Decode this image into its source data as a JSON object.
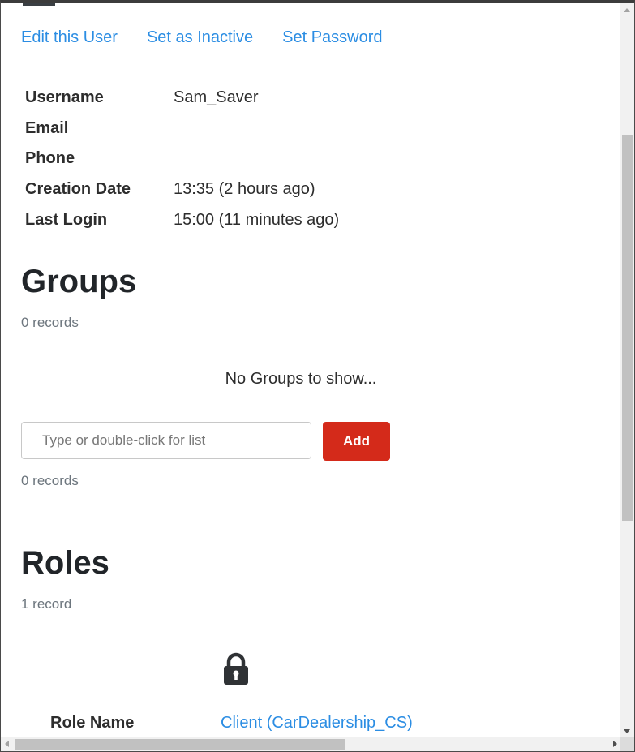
{
  "actions": {
    "edit_user": "Edit this User",
    "set_inactive": "Set as Inactive",
    "set_password": "Set Password"
  },
  "details": [
    {
      "label": "Username",
      "value": "Sam_Saver"
    },
    {
      "label": "Email",
      "value": ""
    },
    {
      "label": "Phone",
      "value": ""
    },
    {
      "label": "Creation Date",
      "value": "13:35 (2 hours ago)"
    },
    {
      "label": "Last Login",
      "value": "15:00 (11 minutes ago)"
    }
  ],
  "groups": {
    "title": "Groups",
    "records_top": "0 records",
    "empty_message": "No Groups to show...",
    "input_placeholder": "Type or double-click for list",
    "input_value": "",
    "add_label": "Add",
    "records_bottom": "0 records"
  },
  "roles": {
    "title": "Roles",
    "records": "1 record",
    "icon": "lock-icon",
    "role_name_label": "Role Name",
    "role_name_value": "Client (CarDealership_CS)"
  },
  "colors": {
    "link": "#2b8de3",
    "add_button": "#d42a1a"
  }
}
